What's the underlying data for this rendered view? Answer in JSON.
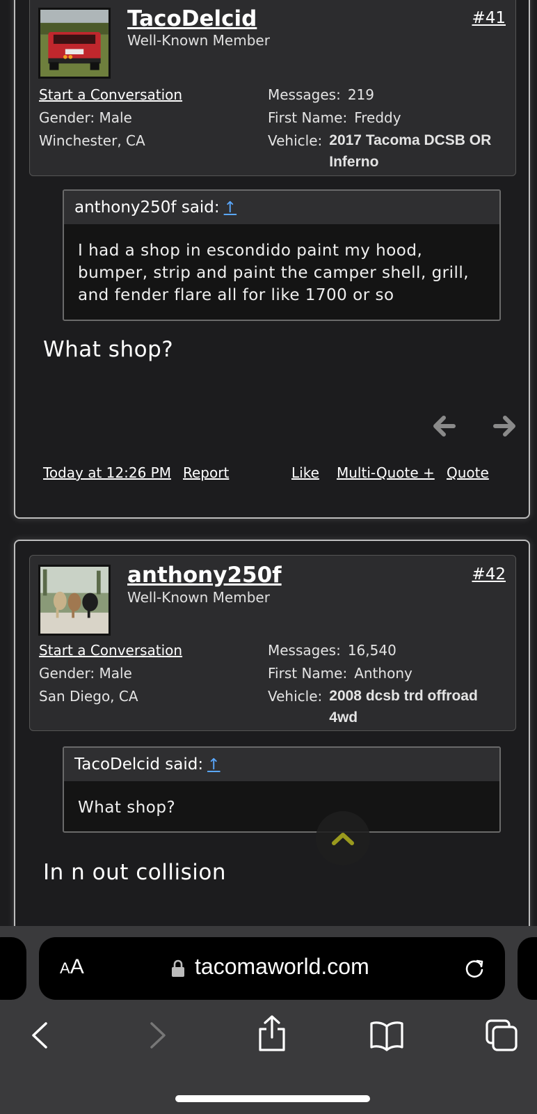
{
  "posts": [
    {
      "username": "TacoDelcid",
      "user_title": "Well-Known Member",
      "post_number": "#41",
      "start_conversation": "Start a Conversation",
      "gender_label": "Gender:",
      "gender": "Male",
      "location": "Winchester, CA",
      "messages_label": "Messages:",
      "messages": "219",
      "first_name_label": "First Name:",
      "first_name": "Freddy",
      "vehicle_label": "Vehicle:",
      "vehicle": "2017 Tacoma DCSB OR Inferno",
      "quote_author": "anthony250f said:",
      "quote_jump": "↑",
      "quote_text": "I had a shop in escondido paint my hood, bumper, strip and paint the camper shell, grill, and fender flare all for like 1700 or so",
      "message": "What shop?",
      "timestamp": "Today at 12:26 PM",
      "report": "Report",
      "like": "Like",
      "multi_quote": "Multi-Quote +",
      "quote_btn": "Quote"
    },
    {
      "username": "anthony250f",
      "user_title": "Well-Known Member",
      "post_number": "#42",
      "start_conversation": "Start a Conversation",
      "gender_label": "Gender:",
      "gender": "Male",
      "location": "San Diego, CA",
      "messages_label": "Messages:",
      "messages": "16,540",
      "first_name_label": "First Name:",
      "first_name": "Anthony",
      "vehicle_label": "Vehicle:",
      "vehicle": "2008 dcsb trd offroad 4wd",
      "quote_author": "TacoDelcid said:",
      "quote_jump": "↑",
      "quote_text": "What shop?",
      "message": "In n out collision"
    }
  ],
  "browser": {
    "text_size_small": "A",
    "text_size_big": "A",
    "url": "tacomaworld.com"
  },
  "icons": {
    "prev_post": "arrow-left-icon",
    "next_post": "arrow-right-icon",
    "scroll_top": "chevron-up-icon",
    "lock": "lock-icon",
    "reload": "reload-icon",
    "back": "back-icon",
    "forward": "forward-icon",
    "share": "share-icon",
    "bookmarks": "book-icon",
    "tabs": "tabs-icon"
  },
  "colors": {
    "background": "#1c1c1e",
    "link_accent": "#5aa8ff",
    "scroll_chevron": "#9a9a1e"
  }
}
